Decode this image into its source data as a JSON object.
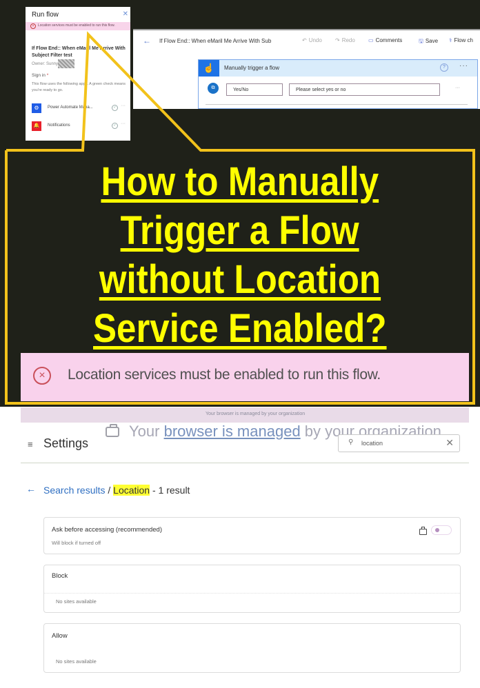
{
  "run_flow_panel": {
    "title": "Run flow",
    "close_glyph": "✕",
    "error_message": "Location services must be enabled to run this flow.",
    "error_icon_glyph": "×",
    "flow_name": "If Flow End:: When eMaril Me Arrive With Subject Filter test",
    "owner_label": "Owner: Sunny",
    "sign_in_label": "Sign in",
    "required_marker": "*",
    "description": "This flow uses the following apps. A green check means you're ready to go.",
    "apps": [
      {
        "label": "Power Automate Mana...",
        "icon": "power-automate-icon",
        "icon_glyph": "⚙",
        "color": "#1f5ce6",
        "check_glyph": "✓",
        "more_glyph": "···"
      },
      {
        "label": "Notifications",
        "icon": "bell-icon",
        "icon_glyph": "🔔",
        "color": "#e8202a",
        "check_glyph": "✓",
        "more_glyph": "···"
      }
    ]
  },
  "editor": {
    "back_glyph": "←",
    "flow_title": "If Flow End:: When eMaril Me Arrive With Sub",
    "toolbar": [
      {
        "label": "Undo",
        "icon": "undo-icon",
        "glyph": "↶",
        "enabled": false
      },
      {
        "label": "Redo",
        "icon": "redo-icon",
        "glyph": "↷",
        "enabled": false
      },
      {
        "label": "Comments",
        "icon": "comment-icon",
        "glyph": "▭",
        "enabled": true
      },
      {
        "label": "Save",
        "icon": "save-icon",
        "glyph": "🖫",
        "enabled": true
      },
      {
        "label": "Flow ch",
        "icon": "stethoscope-icon",
        "glyph": "⚕",
        "enabled": true
      }
    ],
    "trigger_card": {
      "title": "Manually trigger a flow",
      "icon_glyph": "☝",
      "help_glyph": "?",
      "more_glyph": "···",
      "param_icon_glyph": "⧉",
      "param_name": "Yes/No",
      "param_placeholder": "Please select yes or no",
      "param_more_glyph": "···"
    }
  },
  "headline": {
    "lines": [
      "How to Manually",
      "Trigger a Flow",
      "without Location",
      "Service Enabled?"
    ],
    "color": "#ffff00",
    "callout_color": "#f2c21b"
  },
  "error_banner": {
    "icon_glyph": "×",
    "message": "Location services must be enabled to run this flow."
  },
  "settings": {
    "managed_notice_small": "Your browser is managed by your organization",
    "managed_notice": {
      "prefix": "Your ",
      "link": "browser is managed",
      "suffix": " by your organization"
    },
    "menu_glyph": "≡",
    "title": "Settings",
    "search": {
      "icon_glyph": "⚲",
      "value": "location",
      "clear_glyph": "✕"
    },
    "breadcrumb": {
      "back_glyph": "←",
      "link": "Search results",
      "separator": " / ",
      "current": "Location",
      "suffix": " - 1 result"
    },
    "panels": [
      {
        "title": "Ask before accessing (recommended)",
        "subtitle": "Will block if turned off",
        "toggle_on": false,
        "locked": true
      },
      {
        "title": "Block",
        "empty_text": "No sites available"
      },
      {
        "title": "Allow",
        "empty_text": "No sites available"
      }
    ]
  }
}
